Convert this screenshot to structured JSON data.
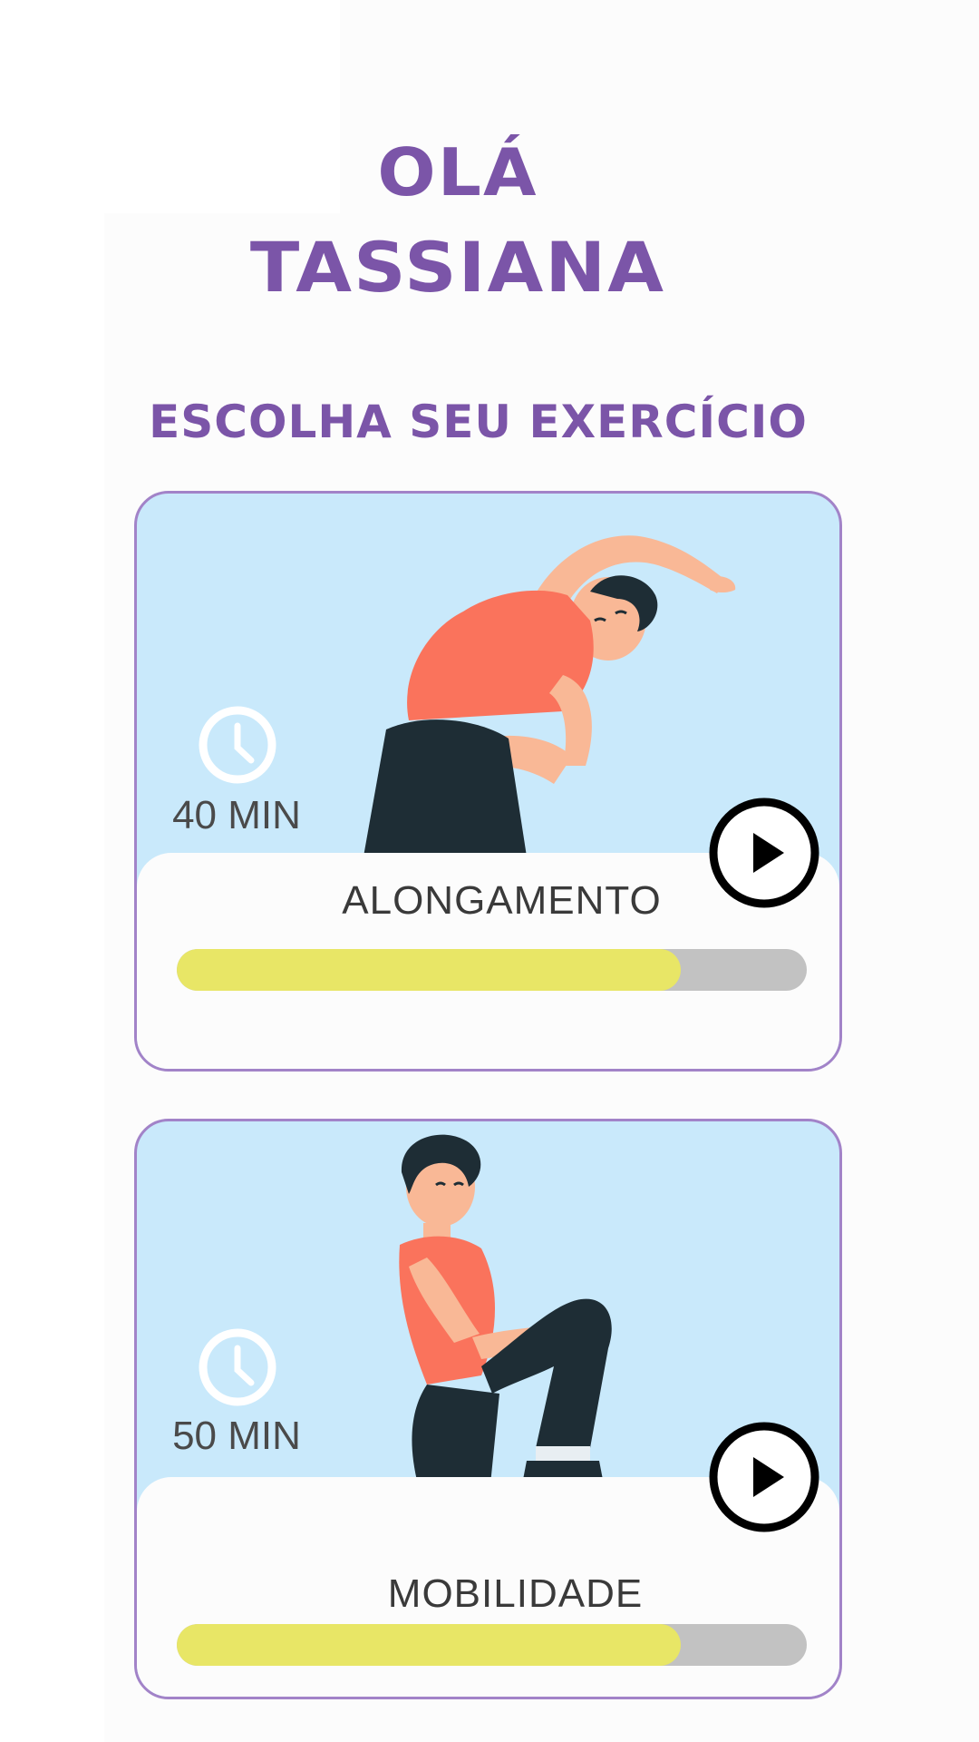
{
  "greeting": {
    "line1": "OLÁ",
    "line2": "TASSIANA"
  },
  "subtitle": "ESCOLHA SEU EXERCÍCIO",
  "exercises": [
    {
      "name": "ALONGAMENTO",
      "duration": "40 MIN",
      "progress": 0.8,
      "icons": [
        "clock-icon",
        "play-icon"
      ]
    },
    {
      "name": "MOBILIDADE",
      "duration": "50 MIN",
      "progress": 0.8,
      "icons": [
        "clock-icon",
        "play-icon"
      ]
    }
  ],
  "colors": {
    "accent": "#7b55a8",
    "card_border": "#a283c8",
    "card_bg": "#c9e9fb",
    "progress_fill": "#e8e666",
    "progress_track": "#c2c2c2"
  }
}
